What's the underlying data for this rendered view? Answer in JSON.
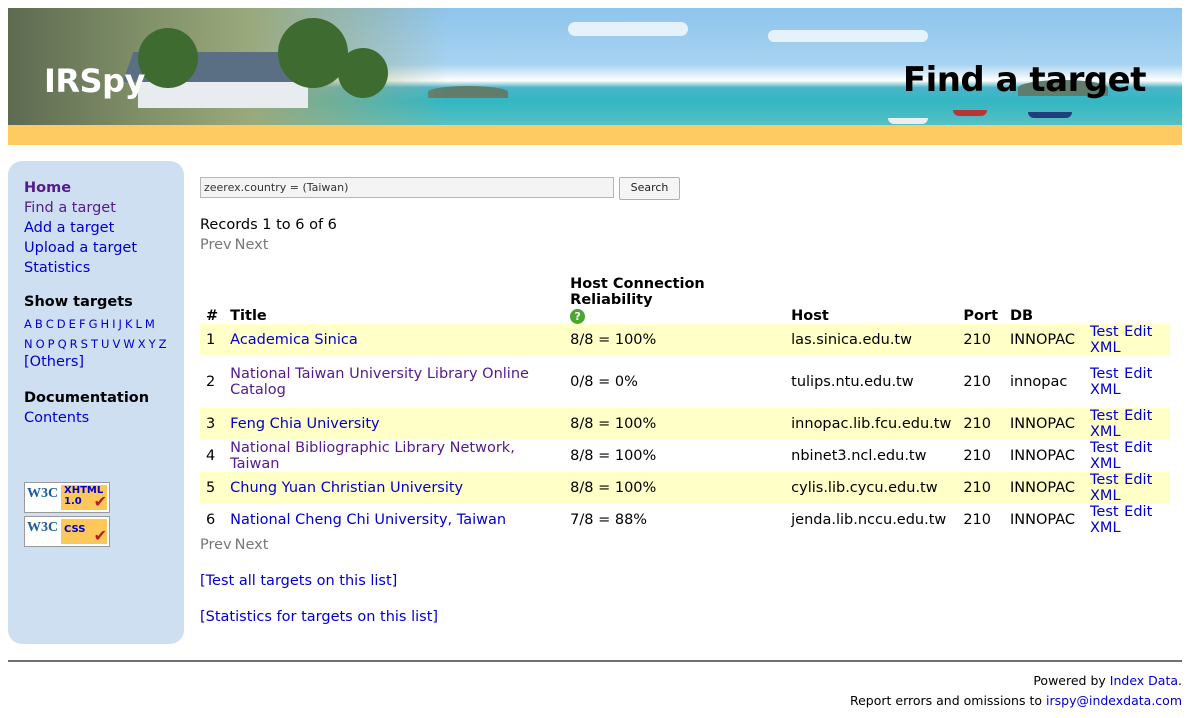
{
  "header": {
    "site_title": "IRSpy",
    "page_title": "Find a target"
  },
  "sidebar": {
    "nav": [
      {
        "label": "Home"
      },
      {
        "label": "Find a target"
      },
      {
        "label": "Add a target"
      },
      {
        "label": "Upload a target"
      },
      {
        "label": "Statistics"
      }
    ],
    "show_targets_heading": "Show targets",
    "letters_row1": [
      "A",
      "B",
      "C",
      "D",
      "E",
      "F",
      "G",
      "H",
      "I",
      "J",
      "K",
      "L",
      "M"
    ],
    "letters_row2": [
      "N",
      "O",
      "P",
      "Q",
      "R",
      "S",
      "T",
      "U",
      "V",
      "W",
      "X",
      "Y",
      "Z"
    ],
    "others": "[Others]",
    "documentation_heading": "Documentation",
    "contents": "Contents",
    "badges": [
      {
        "w3c": "W3C",
        "label1": "XHTML",
        "label2": "1.0"
      },
      {
        "w3c": "W3C",
        "label1": "CSS",
        "label2": ""
      }
    ]
  },
  "search": {
    "value": "zeerex.country = (Taiwan)",
    "button": "Search"
  },
  "records_text": "Records 1 to 6 of 6",
  "pager": {
    "prev": "Prev",
    "next": "Next"
  },
  "table": {
    "headers": {
      "num": "#",
      "title": "Title",
      "reliability": "Host Connection Reliability",
      "host": "Host",
      "port": "Port",
      "db": "DB"
    },
    "help_icon": "?",
    "rows": [
      {
        "num": "1",
        "title": "Academica Sinica",
        "reliability": "8/8 = 100%",
        "host": "las.sinica.edu.tw",
        "port": "210",
        "db": "INNOPAC"
      },
      {
        "num": "2",
        "title": "National Taiwan University Library Online Catalog",
        "reliability": "0/8 = 0%",
        "host": "tulips.ntu.edu.tw",
        "port": "210",
        "db": "innopac"
      },
      {
        "num": "3",
        "title": "Feng Chia University",
        "reliability": "8/8 = 100%",
        "host": "innopac.lib.fcu.edu.tw",
        "port": "210",
        "db": "INNOPAC"
      },
      {
        "num": "4",
        "title": "National Bibliographic Library Network, Taiwan",
        "reliability": "8/8 = 100%",
        "host": "nbinet3.ncl.edu.tw",
        "port": "210",
        "db": "INNOPAC"
      },
      {
        "num": "5",
        "title": "Chung Yuan Christian University",
        "reliability": "8/8 = 100%",
        "host": "cylis.lib.cycu.edu.tw",
        "port": "210",
        "db": "INNOPAC"
      },
      {
        "num": "6",
        "title": "National Cheng Chi University, Taiwan",
        "reliability": "7/8 = 88%",
        "host": "jenda.lib.nccu.edu.tw",
        "port": "210",
        "db": "INNOPAC"
      }
    ],
    "actions": {
      "test": "Test",
      "edit": "Edit",
      "xml": "XML"
    }
  },
  "list_links": {
    "test_all": "[Test all targets on this list]",
    "stats": "[Statistics for targets on this list]"
  },
  "footer": {
    "powered_by": "Powered by",
    "powered_link": "Index Data",
    "period": ".",
    "report_text": "Report errors and omissions to",
    "email": "irspy@indexdata.com"
  },
  "colors": {
    "stripe": "#fecb62",
    "sidebar": "#cddff1",
    "odd_row": "#ffffc8",
    "link": "#0000cc",
    "visited": "#551a8b"
  }
}
